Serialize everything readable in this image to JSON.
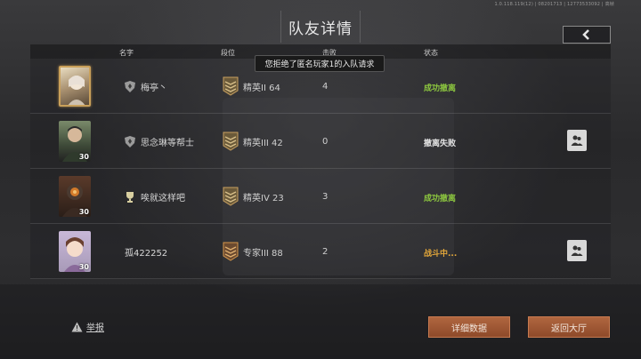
{
  "version_text": "1.0.118.119(12) | 08201713 | 12773533092 | 高帧",
  "header": {
    "title": "队友详情",
    "back_icon": "chevron-left-icon"
  },
  "columns": {
    "name": "名字",
    "rank": "段位",
    "defeats": "击败",
    "status": "状态"
  },
  "toast": "您拒绝了匿名玩家1的入队请求",
  "rows": [
    {
      "name": "梅亭丶",
      "badge": "shield-icon",
      "rank": "精英II 64",
      "defeats": "4",
      "status": "成功撤离",
      "status_type": "success",
      "level": "",
      "add_friend": false
    },
    {
      "name": "思念琳等帮士",
      "badge": "shield-icon",
      "rank": "精英III 42",
      "defeats": "0",
      "status": "撤离失败",
      "status_type": "fail",
      "level": "30",
      "add_friend": true
    },
    {
      "name": "唉就这样吧",
      "badge": "trophy-icon",
      "rank": "精英IV 23",
      "defeats": "3",
      "status": "成功撤离",
      "status_type": "success",
      "level": "30",
      "add_friend": false
    },
    {
      "name": "孤422252",
      "badge": "",
      "rank": "专家III 88",
      "defeats": "2",
      "status": "战斗中...",
      "status_type": "fighting",
      "level": "30",
      "add_friend": true
    }
  ],
  "footer": {
    "report": "举报",
    "detail_button": "详细数据",
    "lobby_button": "返回大厅"
  },
  "colors": {
    "success": "#8cc63f",
    "fighting": "#e3a73a",
    "button": "#a35a35"
  }
}
